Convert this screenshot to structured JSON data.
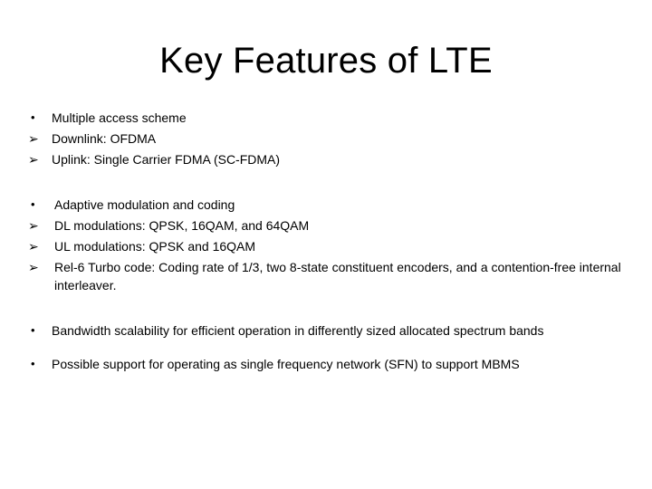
{
  "slide": {
    "title": "Key Features of LTE",
    "background_color": "#ffffff",
    "text_color": "#000000",
    "bullet_glyphs": {
      "disc": "•",
      "arrow": "➢"
    },
    "groups": [
      {
        "id": "multiple-access-scheme",
        "lines": [
          {
            "marker": "disc",
            "text": "Multiple access scheme"
          },
          {
            "marker": "arrow",
            "text": "Downlink: OFDMA"
          },
          {
            "marker": "arrow",
            "text": "Uplink: Single Carrier FDMA (SC-FDMA)"
          }
        ]
      },
      {
        "id": "adaptive-modulation-and-coding",
        "lines": [
          {
            "marker": "disc",
            "text": "Adaptive modulation and coding"
          },
          {
            "marker": "arrow",
            "text": "DL modulations: QPSK, 16QAM, and 64QAM"
          },
          {
            "marker": "arrow",
            "text": "UL modulations: QPSK and 16QAM"
          },
          {
            "marker": "arrow",
            "text": "Rel-6 Turbo code: Coding rate of 1/3, two 8-state constituent encoders, and a  contention-free internal interleaver."
          }
        ]
      },
      {
        "id": "bandwidth-scalability",
        "lines": [
          {
            "marker": "disc",
            "text": "Bandwidth scalability for efficient operation in differently sized allocated spectrum bands"
          }
        ]
      },
      {
        "id": "single-frequency-network",
        "lines": [
          {
            "marker": "disc",
            "text": "Possible support for operating as single frequency network (SFN) to support MBMS"
          }
        ]
      }
    ]
  }
}
